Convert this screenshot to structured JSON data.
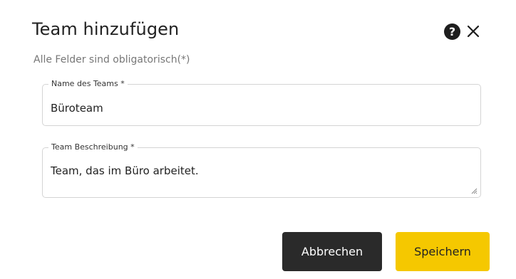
{
  "dialog": {
    "title": "Team hinzufügen",
    "subtitle": "Alle Felder sind obligatorisch(*)",
    "help_icon": "question-circle-icon",
    "close_icon": "close-icon"
  },
  "form": {
    "name": {
      "label": "Name des Teams *",
      "value": "Büroteam"
    },
    "description": {
      "label": "Team Beschreibung *",
      "value": "Team, das im Büro arbeitet."
    }
  },
  "actions": {
    "cancel_label": "Abbrechen",
    "save_label": "Speichern"
  },
  "colors": {
    "save_button": "#f5c800",
    "cancel_button": "#2a2a2a",
    "text": "#222222"
  }
}
